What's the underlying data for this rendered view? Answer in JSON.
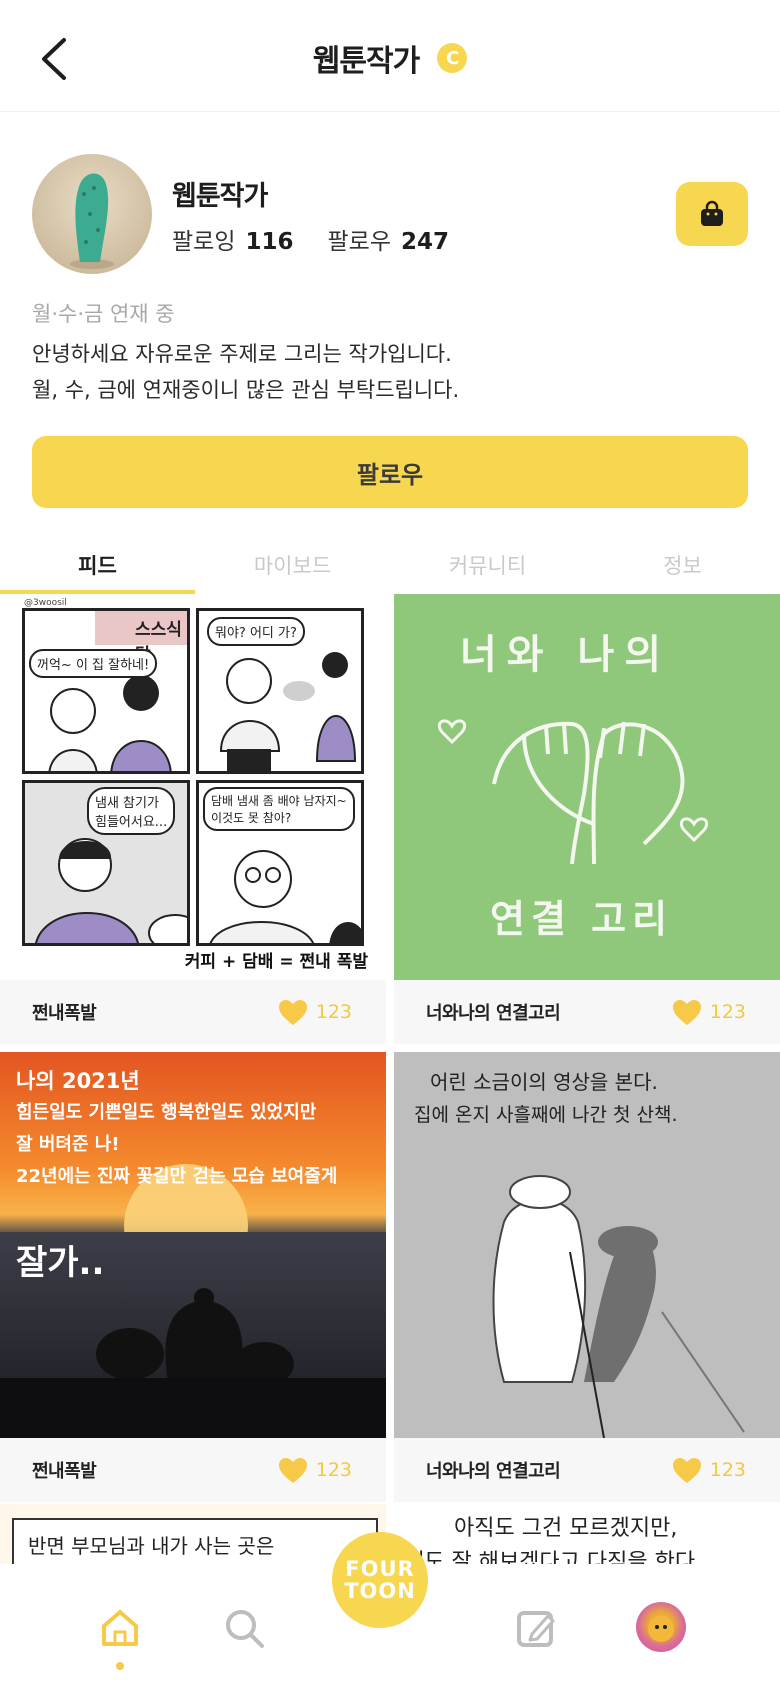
{
  "header": {
    "title": "웹툰작가",
    "coin_icon": "C"
  },
  "profile": {
    "name": "웹툰작가",
    "following_label": "팔로잉",
    "following_count": "116",
    "follower_label": "팔로우",
    "follower_count": "247",
    "schedule": "월·수·금 연재 중",
    "bio_line1": "안녕하세요 자유로운 주제로 그리는 작가입니다.",
    "bio_line2": "월, 수, 금에 연재중이니 많은 관심 부탁드립니다.",
    "follow_button": "팔로우"
  },
  "tabs": [
    {
      "label": "피드",
      "active": true
    },
    {
      "label": "마이보드",
      "active": false
    },
    {
      "label": "커뮤니티",
      "active": false
    },
    {
      "label": "정보",
      "active": false
    }
  ],
  "feed": [
    {
      "title": "쩐내폭발",
      "likes": "123",
      "comic": {
        "watermark": "@3woosil",
        "sign": "스스식당",
        "b1": "꺼억~ 이 집 잘하네!",
        "b2": "뭐야? 어디 가?",
        "b3": "냄새 참기가",
        "b3b": "힘들어서요...",
        "b4": "담배 냄새 좀 배야 남자지~",
        "b4b": "이것도 못 참아?",
        "caption": "커피 + 담배 = 쩐내 폭발"
      }
    },
    {
      "title": "너와나의 연결고리",
      "likes": "123",
      "comic": {
        "top": "너와 나의",
        "bottom": "연결 고리"
      }
    },
    {
      "title": "쩐내폭발",
      "likes": "123",
      "comic": {
        "l1": "나의 2021년",
        "l2": "힘든일도 기쁜일도 행복한일도 있었지만",
        "l3": "잘 버텨준 나!",
        "l4": "22년에는 진짜 꽃길만 걷는 모습 보여줄게",
        "l5": "잘가.."
      }
    },
    {
      "title": "너와나의 연결고리",
      "likes": "123",
      "comic": {
        "l1": "어린 소금이의 영상을 본다.",
        "l2": "집에 온지 사흘째에 나간 첫 산책."
      }
    }
  ],
  "partial": {
    "left_text": "반면 부모님과 내가 사는 곳은",
    "right_line1": "아직도 그건 모르겠지만,",
    "right_line2": "래도 잘 해보겠다고 다짐을 한다"
  },
  "bottom_nav": {
    "fab_line1": "FOUR",
    "fab_line2": "TOON"
  },
  "colors": {
    "accent": "#f7d650",
    "like": "#f7c948",
    "tab_inactive": "#c9c9c9"
  }
}
